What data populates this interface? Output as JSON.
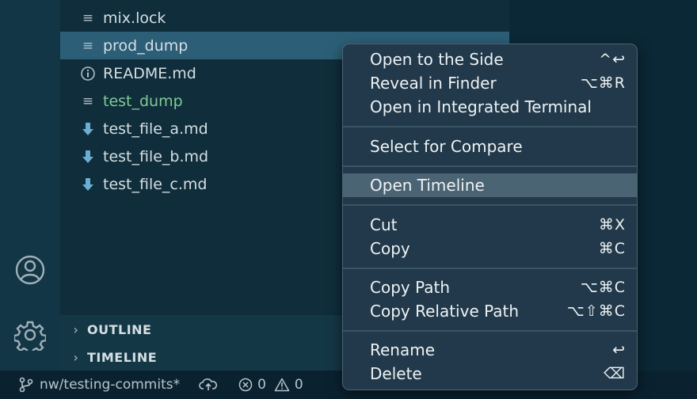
{
  "explorer": {
    "files": [
      {
        "name": "mix.lock",
        "icon": "lines-file-icon"
      },
      {
        "name": "prod_dump",
        "icon": "lines-file-icon"
      },
      {
        "name": "README.md",
        "icon": "info-icon"
      },
      {
        "name": "test_dump",
        "icon": "lines-file-icon"
      },
      {
        "name": "test_file_a.md",
        "icon": "markdown-down-arrow-icon"
      },
      {
        "name": "test_file_b.md",
        "icon": "markdown-down-arrow-icon"
      },
      {
        "name": "test_file_c.md",
        "icon": "markdown-down-arrow-icon"
      }
    ],
    "sections": [
      {
        "label": "OUTLINE"
      },
      {
        "label": "TIMELINE"
      }
    ]
  },
  "status": {
    "branch": "nw/testing-commits*",
    "errors": "0",
    "warnings": "0"
  },
  "context_menu": {
    "items": [
      {
        "label": "Open to the Side",
        "shortcut": "^↩"
      },
      {
        "label": "Reveal in Finder",
        "shortcut": "⌥⌘R"
      },
      {
        "label": "Open in Integrated Terminal",
        "shortcut": ""
      },
      {
        "label": "Select for Compare",
        "shortcut": ""
      },
      {
        "label": "Open Timeline",
        "shortcut": ""
      },
      {
        "label": "Cut",
        "shortcut": "⌘X"
      },
      {
        "label": "Copy",
        "shortcut": "⌘C"
      },
      {
        "label": "Copy Path",
        "shortcut": "⌥⌘C"
      },
      {
        "label": "Copy Relative Path",
        "shortcut": "⌥⇧⌘C"
      },
      {
        "label": "Rename",
        "shortcut": "↩"
      },
      {
        "label": "Delete",
        "shortcut": "⌫"
      }
    ]
  },
  "colors": {
    "modified_file": "#81c995",
    "selected_row": "#2c5f77",
    "menu_highlight": "#4b6474"
  }
}
